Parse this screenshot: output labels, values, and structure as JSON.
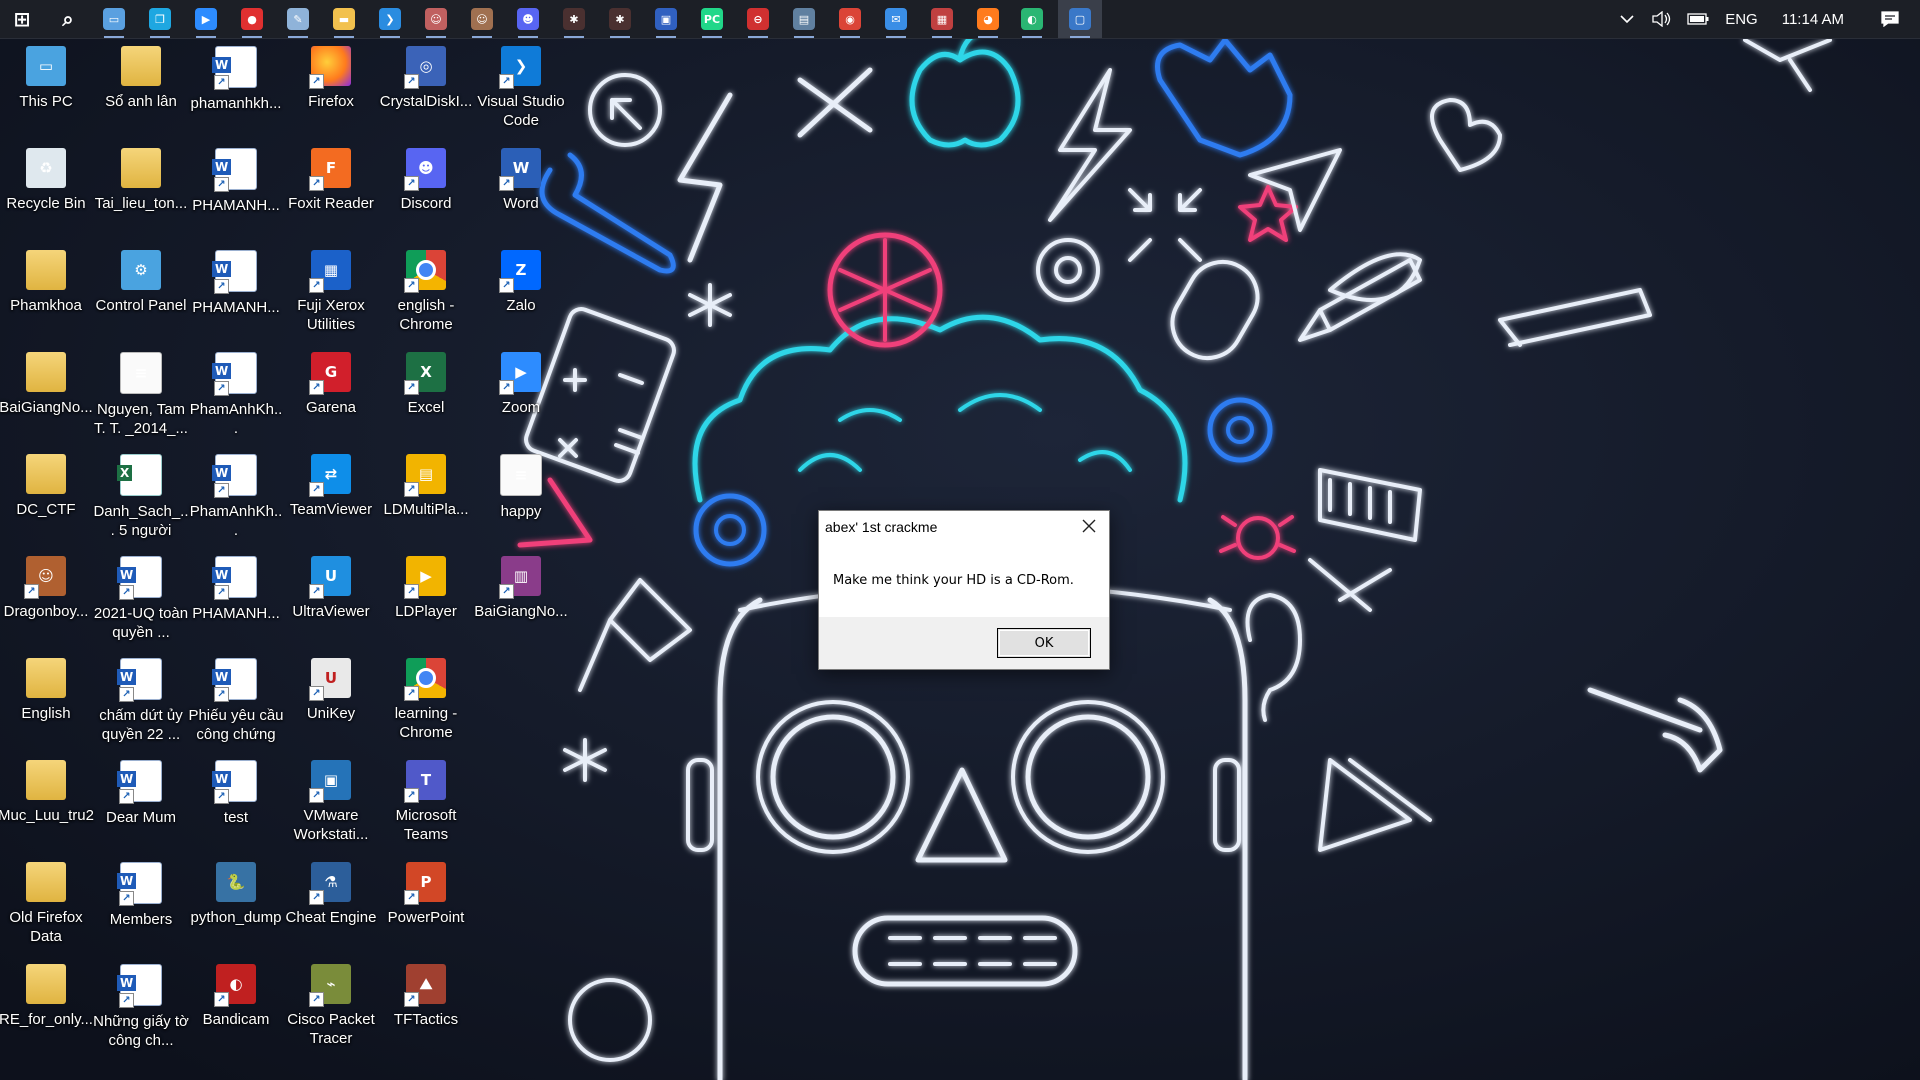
{
  "taskbar": {
    "apps": [
      {
        "name": "start",
        "icon": "windows-icon",
        "color": "#ffffff"
      },
      {
        "name": "search",
        "icon": "search-icon",
        "color": "#ffffff"
      },
      {
        "name": "task-manager",
        "icon": "monitor-icon",
        "color": "#5aa0e0"
      },
      {
        "name": "copy-app",
        "icon": "copy-icon",
        "color": "#1ea7e1"
      },
      {
        "name": "zoom",
        "icon": "zoom-icon",
        "color": "#2d8cff"
      },
      {
        "name": "recorder",
        "icon": "record-icon",
        "color": "#e03030"
      },
      {
        "name": "notes",
        "icon": "note-icon",
        "color": "#8fb3d9"
      },
      {
        "name": "file-explorer",
        "icon": "folder-icon",
        "color": "#f2c14e"
      },
      {
        "name": "vscode",
        "icon": "vscode-icon",
        "color": "#2a8ce0"
      },
      {
        "name": "profile-1",
        "icon": "person-icon",
        "color": "#c06060"
      },
      {
        "name": "profile-2",
        "icon": "person-icon",
        "color": "#a07050"
      },
      {
        "name": "discord",
        "icon": "discord-icon",
        "color": "#5865f2"
      },
      {
        "name": "bug-1",
        "icon": "bug-icon",
        "color": "#4a3030"
      },
      {
        "name": "bug-2",
        "icon": "bug-icon",
        "color": "#4a3030"
      },
      {
        "name": "debugger",
        "icon": "debugger-icon",
        "color": "#3060c0"
      },
      {
        "name": "pycharm",
        "icon": "pycharm-icon",
        "color": "#21d789"
      },
      {
        "name": "ida",
        "icon": "ida-icon",
        "color": "#d03030"
      },
      {
        "name": "tool",
        "icon": "tool-icon",
        "color": "#6080a0"
      },
      {
        "name": "chrome",
        "icon": "chrome-icon",
        "color": "#db4437"
      },
      {
        "name": "mail",
        "icon": "mail-icon",
        "color": "#3a8ee6"
      },
      {
        "name": "photos",
        "icon": "photos-icon",
        "color": "#c04040"
      },
      {
        "name": "firefox",
        "icon": "firefox-icon",
        "color": "#ff7b1d"
      },
      {
        "name": "edge",
        "icon": "edge-icon",
        "color": "#2ab673"
      },
      {
        "name": "crackme",
        "icon": "window-icon",
        "color": "#3a78c8"
      }
    ],
    "tray": {
      "language": "ENG",
      "time": "11:14 AM"
    }
  },
  "desktop": {
    "icons": [
      {
        "label": "This PC",
        "type": "pc",
        "col": 0,
        "row": 0
      },
      {
        "label": "Recycle Bin",
        "type": "bin",
        "col": 0,
        "row": 1
      },
      {
        "label": "Phamkhoa",
        "type": "folder",
        "col": 0,
        "row": 2
      },
      {
        "label": "BaiGiangNo...",
        "type": "folder",
        "col": 0,
        "row": 3
      },
      {
        "label": "DC_CTF",
        "type": "folder",
        "col": 0,
        "row": 4
      },
      {
        "label": "Dragonboy...",
        "type": "app",
        "col": 0,
        "row": 5
      },
      {
        "label": "English",
        "type": "folder",
        "col": 0,
        "row": 6
      },
      {
        "label": "Muc_Luu_tru2",
        "type": "folder",
        "col": 0,
        "row": 7
      },
      {
        "label": "Old Firefox Data",
        "type": "folder",
        "col": 0,
        "row": 8
      },
      {
        "label": "RE_for_only...",
        "type": "folder",
        "col": 0,
        "row": 9
      },
      {
        "label": "Sổ anh lân",
        "type": "folder",
        "col": 1,
        "row": 0
      },
      {
        "label": "Tai_lieu_ton...",
        "type": "folder",
        "col": 1,
        "row": 1
      },
      {
        "label": "Control Panel",
        "type": "control",
        "col": 1,
        "row": 2
      },
      {
        "label": "Nguyen, Tam T. T. _2014_...",
        "type": "doc",
        "col": 1,
        "row": 3
      },
      {
        "label": "Danh_Sach_... 5 người",
        "type": "excel",
        "col": 1,
        "row": 4
      },
      {
        "label": "2021-UQ toàn quyền ...",
        "type": "word",
        "col": 1,
        "row": 5
      },
      {
        "label": "chấm dứt ủy quyền 22 ...",
        "type": "word",
        "col": 1,
        "row": 6
      },
      {
        "label": "Dear Mum",
        "type": "word",
        "col": 1,
        "row": 7
      },
      {
        "label": "Members",
        "type": "word",
        "col": 1,
        "row": 8
      },
      {
        "label": "Những giấy tờ công ch...",
        "type": "word",
        "col": 1,
        "row": 9
      },
      {
        "label": "phamanhkh...",
        "type": "word",
        "col": 2,
        "row": 0
      },
      {
        "label": "PHAMANH...",
        "type": "word",
        "col": 2,
        "row": 1
      },
      {
        "label": "PHAMANH...",
        "type": "word",
        "col": 2,
        "row": 2
      },
      {
        "label": "PhamAnhKh...",
        "type": "word",
        "col": 2,
        "row": 3
      },
      {
        "label": "PhamAnhKh...",
        "type": "word",
        "col": 2,
        "row": 4
      },
      {
        "label": "PHAMANH...",
        "type": "word",
        "col": 2,
        "row": 5
      },
      {
        "label": "Phiếu yêu cầu công chứng",
        "type": "word",
        "col": 2,
        "row": 6
      },
      {
        "label": "test",
        "type": "word",
        "col": 2,
        "row": 7
      },
      {
        "label": "python_dump",
        "type": "python",
        "col": 2,
        "row": 8
      },
      {
        "label": "Bandicam",
        "type": "bandicam",
        "col": 2,
        "row": 9
      },
      {
        "label": "Firefox",
        "type": "firefox",
        "col": 3,
        "row": 0
      },
      {
        "label": "Foxit Reader",
        "type": "foxit",
        "col": 3,
        "row": 1
      },
      {
        "label": "Fuji Xerox Utilities",
        "type": "fuji",
        "col": 3,
        "row": 2
      },
      {
        "label": "Garena",
        "type": "garena",
        "col": 3,
        "row": 3
      },
      {
        "label": "TeamViewer",
        "type": "teamviewer",
        "col": 3,
        "row": 4
      },
      {
        "label": "UltraViewer",
        "type": "ultraviewer",
        "col": 3,
        "row": 5
      },
      {
        "label": "UniKey",
        "type": "unikey",
        "col": 3,
        "row": 6
      },
      {
        "label": "VMware Workstati...",
        "type": "vmware",
        "col": 3,
        "row": 7
      },
      {
        "label": "Cheat Engine",
        "type": "cheatengine",
        "col": 3,
        "row": 8
      },
      {
        "label": "Cisco Packet Tracer",
        "type": "cisco",
        "col": 3,
        "row": 9
      },
      {
        "label": "CrystalDiskI...",
        "type": "crystal",
        "col": 4,
        "row": 0
      },
      {
        "label": "Discord",
        "type": "discord",
        "col": 4,
        "row": 1
      },
      {
        "label": "english - Chrome",
        "type": "chrome",
        "col": 4,
        "row": 2
      },
      {
        "label": "Excel",
        "type": "excelapp",
        "col": 4,
        "row": 3
      },
      {
        "label": "LDMultiPla...",
        "type": "ldmulti",
        "col": 4,
        "row": 4
      },
      {
        "label": "LDPlayer",
        "type": "ldplayer",
        "col": 4,
        "row": 5
      },
      {
        "label": "learning - Chrome",
        "type": "chrome",
        "col": 4,
        "row": 6
      },
      {
        "label": "Microsoft Teams",
        "type": "teams",
        "col": 4,
        "row": 7
      },
      {
        "label": "PowerPoint",
        "type": "powerpoint",
        "col": 4,
        "row": 8
      },
      {
        "label": "TFTactics",
        "type": "tft",
        "col": 4,
        "row": 9
      },
      {
        "label": "Visual Studio Code",
        "type": "vscode",
        "col": 5,
        "row": 0
      },
      {
        "label": "Word",
        "type": "wordapp",
        "col": 5,
        "row": 1
      },
      {
        "label": "Zalo",
        "type": "zalo",
        "col": 5,
        "row": 2
      },
      {
        "label": "Zoom",
        "type": "zoom",
        "col": 5,
        "row": 3
      },
      {
        "label": "happy",
        "type": "txt",
        "col": 5,
        "row": 4
      },
      {
        "label": "BaiGiangNo...",
        "type": "winrar",
        "col": 5,
        "row": 5
      }
    ]
  },
  "dialog": {
    "title": "abex' 1st crackme",
    "message": "Make me think your HD is a CD-Rom.",
    "ok_label": "OK"
  },
  "colors": {
    "neon_cyan": "#2fd6e8",
    "neon_blue": "#2f7cf0",
    "neon_pink": "#f0407a",
    "neon_white": "#e8eef8"
  }
}
